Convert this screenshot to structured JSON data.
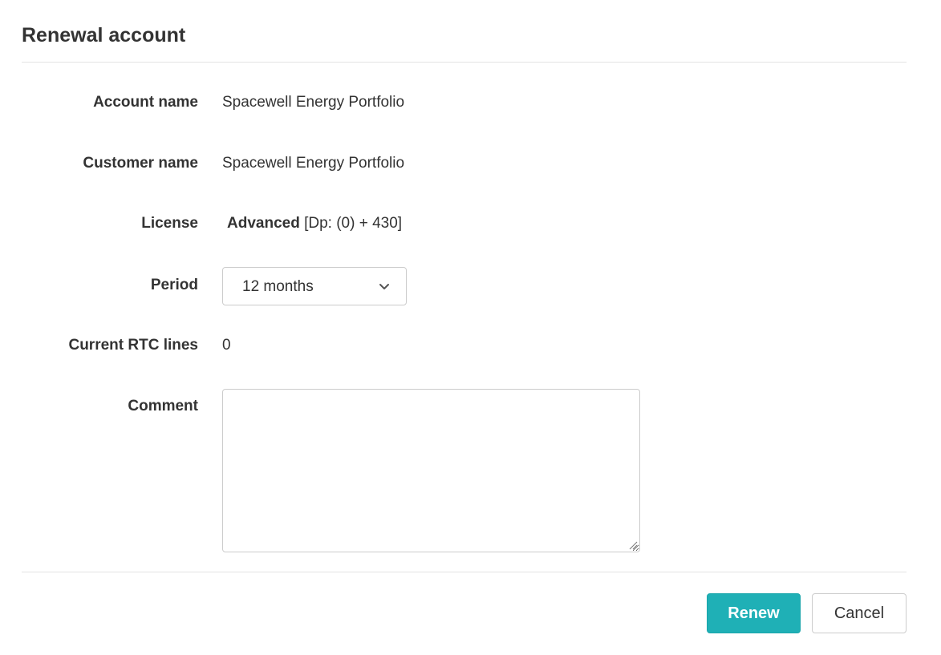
{
  "dialog": {
    "title": "Renewal account"
  },
  "fields": {
    "account_name": {
      "label": "Account name",
      "value": "Spacewell Energy Portfolio"
    },
    "customer_name": {
      "label": "Customer name",
      "value": "Spacewell Energy Portfolio"
    },
    "license": {
      "label": "License",
      "name": "Advanced",
      "detail": "[Dp: (0) + 430]"
    },
    "period": {
      "label": "Period",
      "selected": "12 months",
      "icon": "chevron-down-icon"
    },
    "current_rtc_lines": {
      "label": "Current RTC lines",
      "value": "0"
    },
    "comment": {
      "label": "Comment",
      "value": "",
      "placeholder": ""
    }
  },
  "actions": {
    "renew_label": "Renew",
    "cancel_label": "Cancel"
  },
  "colors": {
    "primary": "#1fb0b6",
    "text": "#333333",
    "border": "#cccccc",
    "divider": "#e3e3e3"
  }
}
